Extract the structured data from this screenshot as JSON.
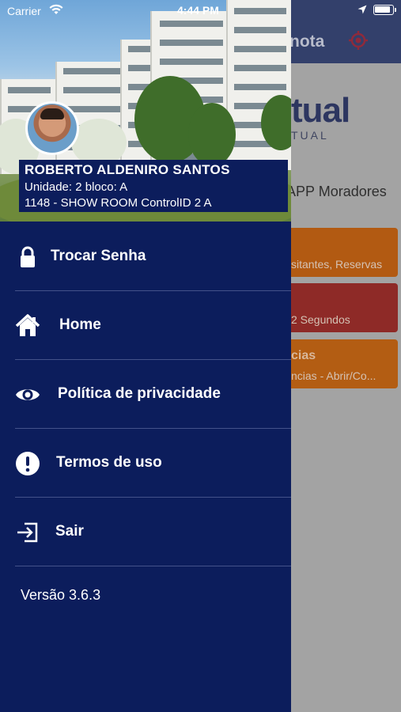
{
  "status_bar": {
    "carrier": "Carrier",
    "time": "4:44 PM"
  },
  "background": {
    "header_title": "nota",
    "logo_main": "tual",
    "logo_sub": "TUAL",
    "subtitle": "APP Moradores",
    "cards": [
      {
        "title": "",
        "text": "sitantes, Reservas",
        "color": "#b25a12"
      },
      {
        "title": "",
        "text": "2 Segundos",
        "color": "#8e2a27"
      },
      {
        "title": "cias",
        "text": "ncias - Abrir/Co...",
        "color": "#b35d13"
      }
    ]
  },
  "drawer": {
    "user": {
      "name": "ROBERTO ALDENIRO SANTOS",
      "unit": "Unidade: 2 bloco: A",
      "condo": "1148 - SHOW ROOM ControlID 2 A"
    },
    "menu": [
      {
        "label": "Trocar Senha",
        "icon": "lock-icon"
      },
      {
        "label": "Home",
        "icon": "home-icon"
      },
      {
        "label": "Política de privacidade",
        "icon": "eye-icon"
      },
      {
        "label": "Termos de uso",
        "icon": "alert-circle-icon"
      },
      {
        "label": "Sair",
        "icon": "logout-icon"
      }
    ],
    "version": "Versão 3.6.3"
  },
  "colors": {
    "drawer_bg": "#0c1d5c",
    "divider": "#44528a",
    "accent_red": "#c0102a"
  }
}
